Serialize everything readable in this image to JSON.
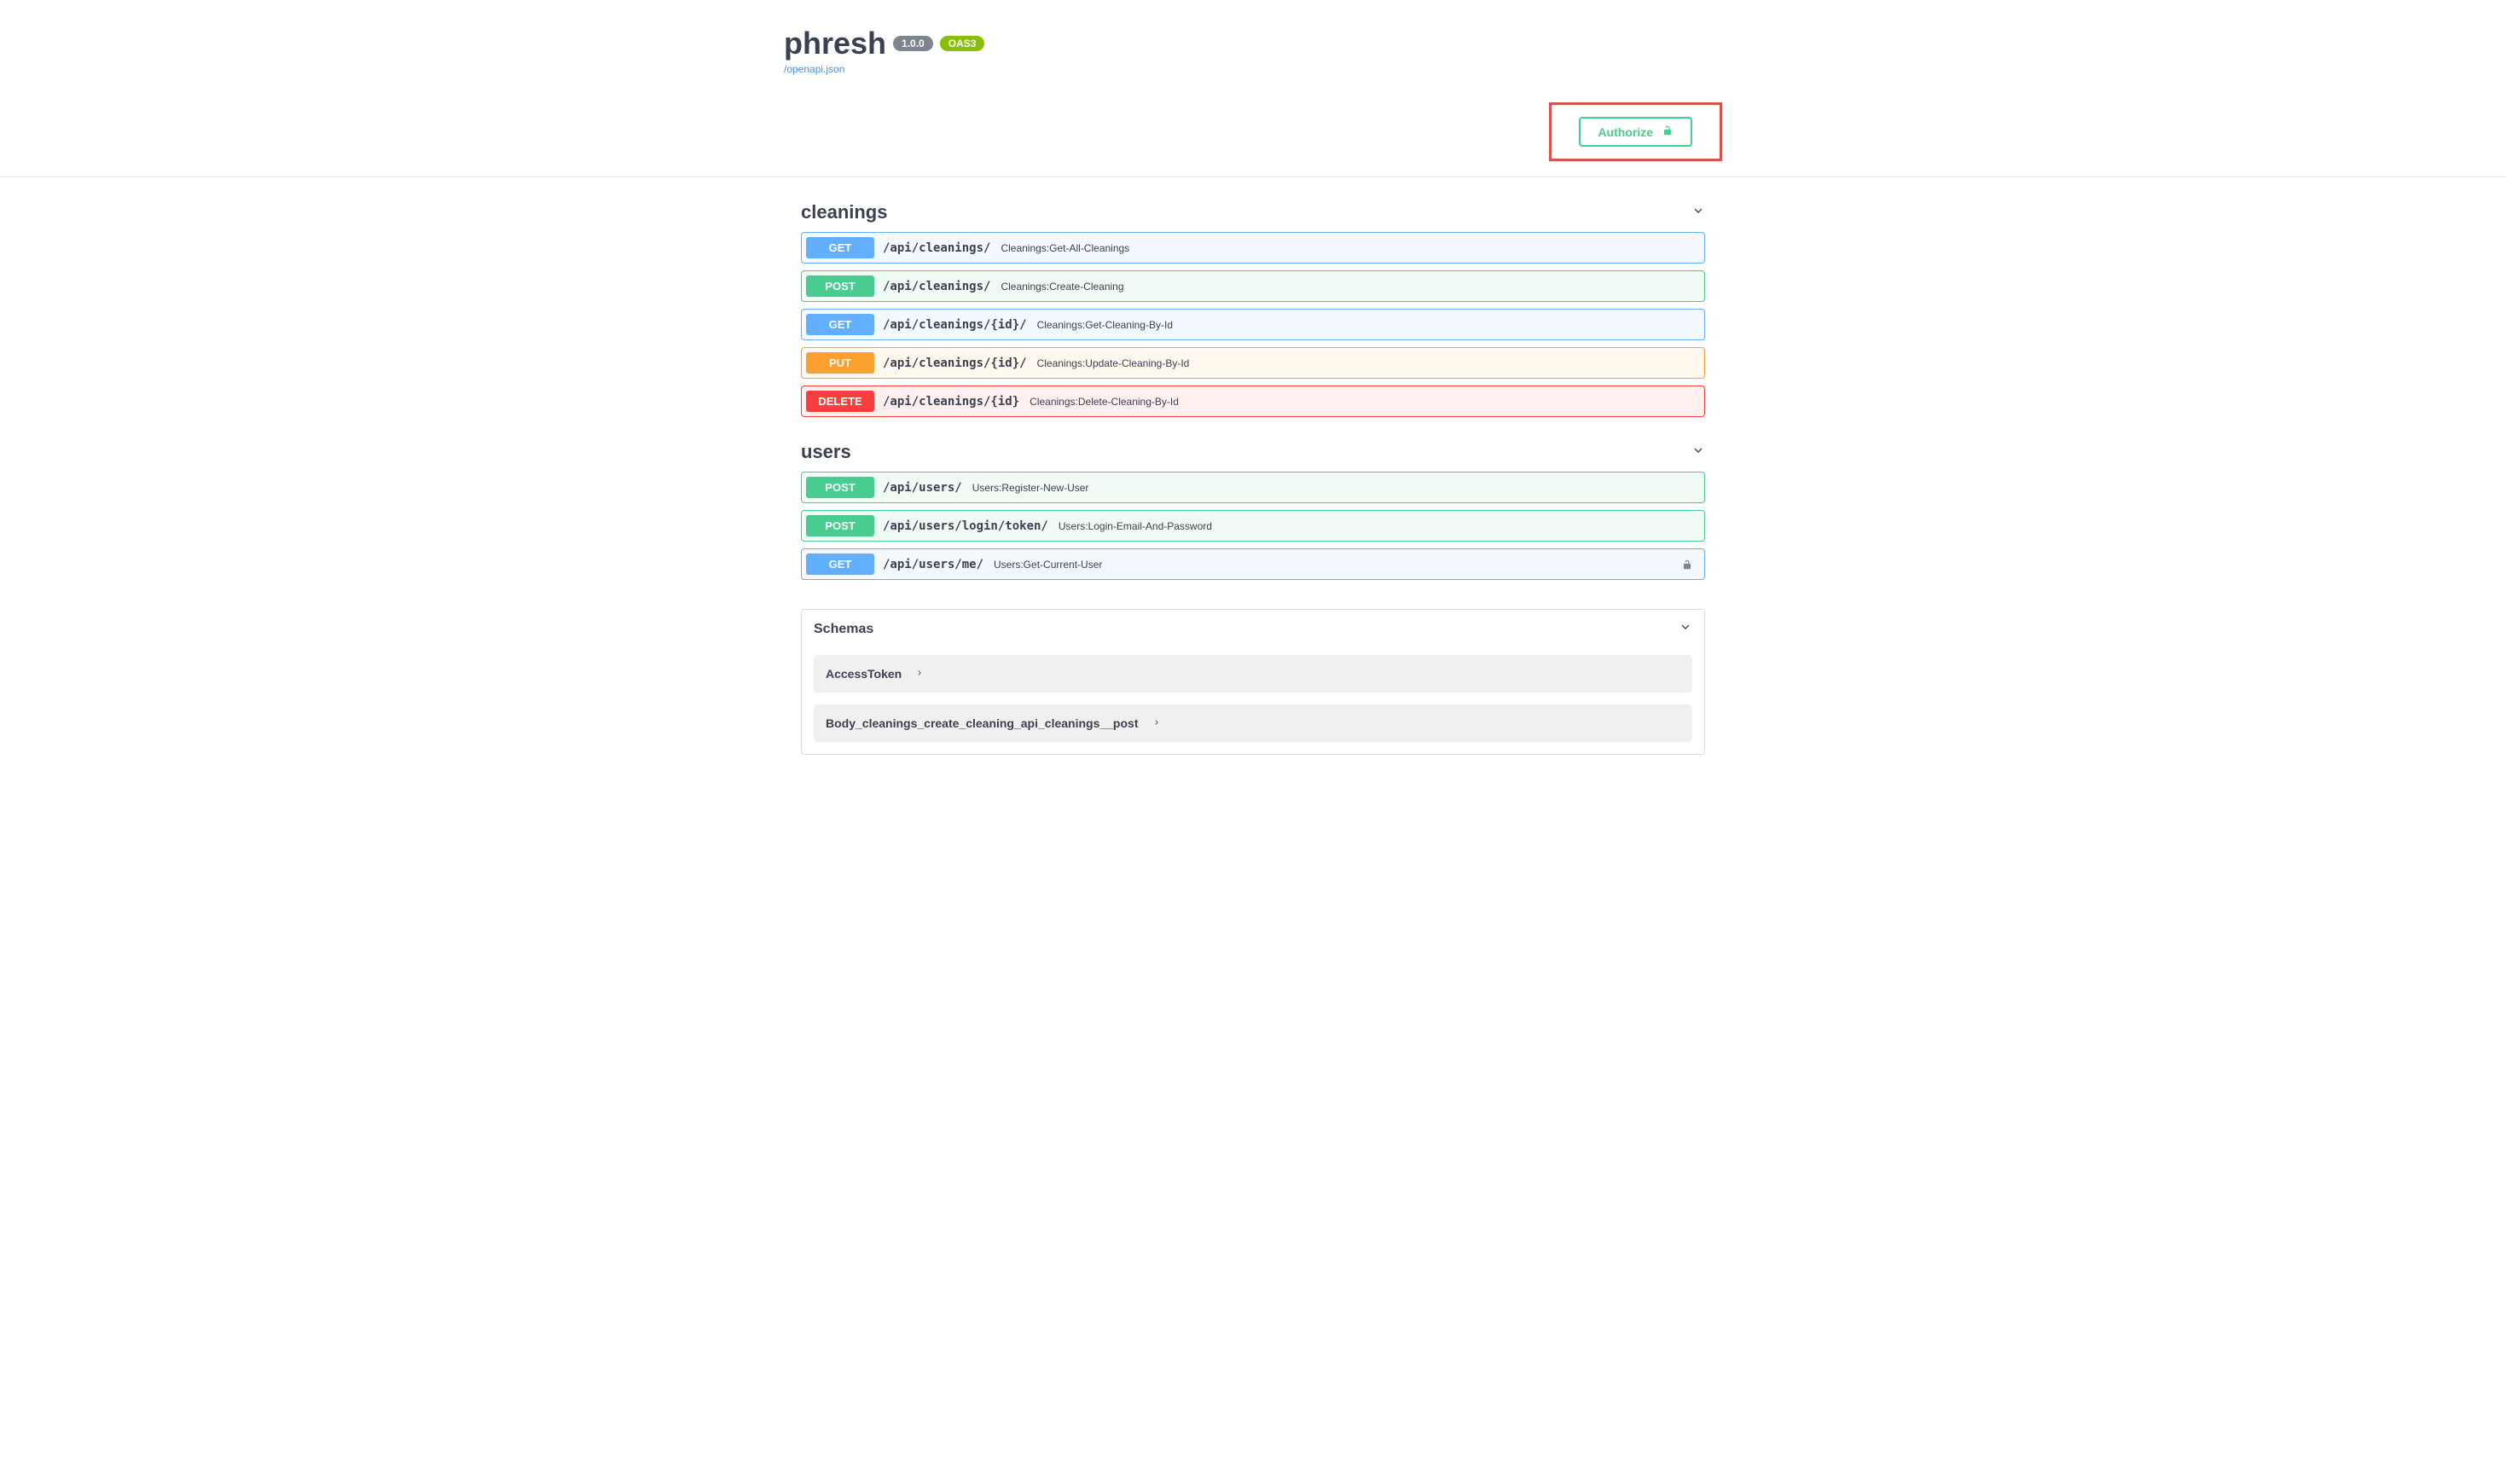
{
  "header": {
    "title": "phresh",
    "version": "1.0.0",
    "oas": "OAS3",
    "spec_link": "/openapi.json"
  },
  "auth": {
    "authorize_label": "Authorize"
  },
  "tags": [
    {
      "name": "cleanings",
      "endpoints": [
        {
          "method": "GET",
          "path": "/api/cleanings/",
          "summary": "Cleanings:Get-All-Cleanings",
          "locked": false
        },
        {
          "method": "POST",
          "path": "/api/cleanings/",
          "summary": "Cleanings:Create-Cleaning",
          "locked": false
        },
        {
          "method": "GET",
          "path": "/api/cleanings/{id}/",
          "summary": "Cleanings:Get-Cleaning-By-Id",
          "locked": false
        },
        {
          "method": "PUT",
          "path": "/api/cleanings/{id}/",
          "summary": "Cleanings:Update-Cleaning-By-Id",
          "locked": false
        },
        {
          "method": "DELETE",
          "path": "/api/cleanings/{id}",
          "summary": "Cleanings:Delete-Cleaning-By-Id",
          "locked": false
        }
      ]
    },
    {
      "name": "users",
      "endpoints": [
        {
          "method": "POST",
          "path": "/api/users/",
          "summary": "Users:Register-New-User",
          "locked": false
        },
        {
          "method": "POST",
          "path": "/api/users/login/token/",
          "summary": "Users:Login-Email-And-Password",
          "locked": false
        },
        {
          "method": "GET",
          "path": "/api/users/me/",
          "summary": "Users:Get-Current-User",
          "locked": true
        }
      ]
    }
  ],
  "schemas": {
    "title": "Schemas",
    "items": [
      "AccessToken",
      "Body_cleanings_create_cleaning_api_cleanings__post"
    ]
  }
}
